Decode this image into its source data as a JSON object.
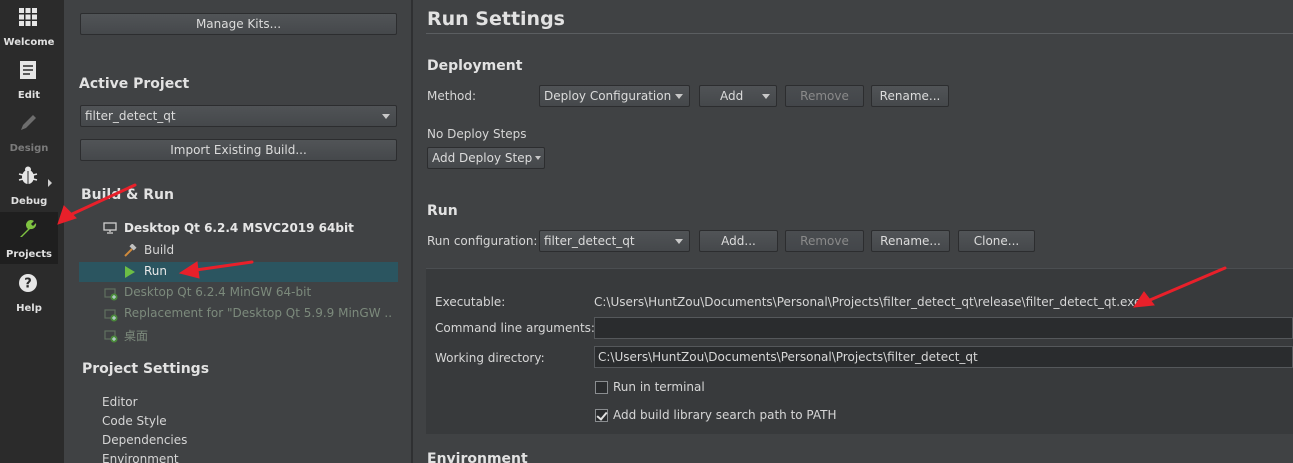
{
  "modebar": {
    "items": [
      {
        "label": "Welcome",
        "icon": "grid-icon"
      },
      {
        "label": "Edit",
        "icon": "document-icon"
      },
      {
        "label": "Design",
        "icon": "pencil-icon"
      },
      {
        "label": "Debug",
        "icon": "bug-icon"
      },
      {
        "label": "Projects",
        "icon": "wrench-icon"
      },
      {
        "label": "Help",
        "icon": "question-icon"
      }
    ],
    "active": "Projects"
  },
  "leftpanel": {
    "manage_kits": "Manage Kits...",
    "active_project_heading": "Active Project",
    "project_combo": "filter_detect_qt",
    "import_build": "Import Existing Build...",
    "build_run_heading": "Build & Run",
    "kits": [
      {
        "name": "Desktop Qt 6.2.4 MSVC2019 64bit",
        "enabled": true
      },
      {
        "name": "Desktop Qt 6.2.4 MinGW 64-bit",
        "enabled": false
      },
      {
        "name": "Replacement for \"Desktop Qt 5.9.9 MinGW ...",
        "enabled": false
      },
      {
        "name": "桌面",
        "enabled": false
      }
    ],
    "kit_children": {
      "build": "Build",
      "run": "Run"
    },
    "project_settings_heading": "Project Settings",
    "settings": [
      "Editor",
      "Code Style",
      "Dependencies",
      "Environment"
    ]
  },
  "content": {
    "title": "Run Settings",
    "deployment": {
      "heading": "Deployment",
      "method_label": "Method:",
      "method_value": "Deploy Configuration",
      "add": "Add",
      "remove": "Remove",
      "rename": "Rename...",
      "no_steps": "No Deploy Steps",
      "add_step": "Add Deploy Step"
    },
    "run": {
      "heading": "Run",
      "config_label": "Run configuration:",
      "config_value": "filter_detect_qt",
      "add": "Add...",
      "remove": "Remove",
      "rename": "Rename...",
      "clone": "Clone...",
      "executable_label": "Executable:",
      "executable_value": "C:\\Users\\HuntZou\\Documents\\Personal\\Projects\\filter_detect_qt\\release\\filter_detect_qt.exe",
      "args_label": "Command line arguments:",
      "args_value": "",
      "workdir_label": "Working directory:",
      "workdir_value": "C:\\Users\\HuntZou\\Documents\\Personal\\Projects\\filter_detect_qt",
      "run_in_terminal": "Run in terminal",
      "run_in_terminal_checked": false,
      "add_lib_path": "Add build library search path to PATH",
      "add_lib_path_checked": true
    },
    "environment_heading": "Environment"
  },
  "colors": {
    "annotation_arrow": "#e8202a",
    "selection": "#2b5560"
  }
}
